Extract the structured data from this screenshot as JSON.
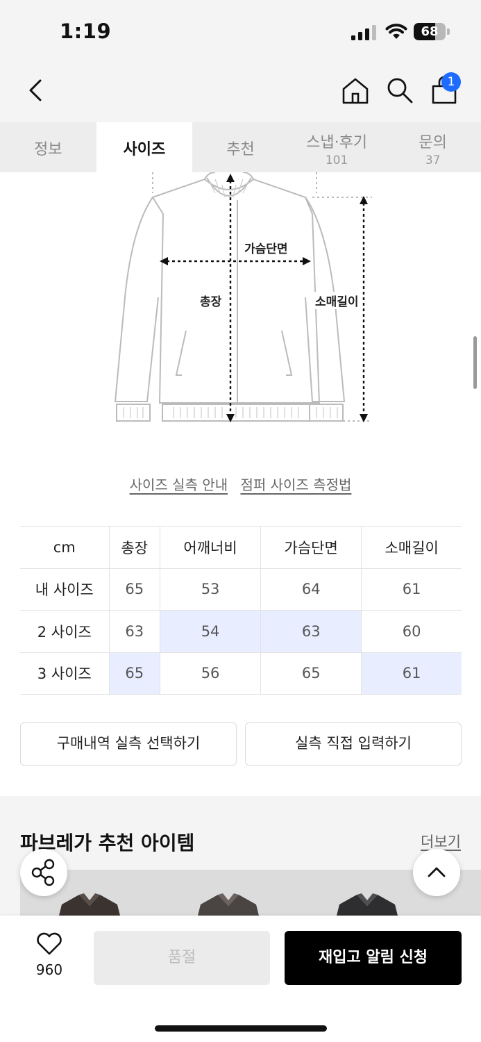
{
  "status": {
    "time": "1:19",
    "battery": "68",
    "battery_level": 0.68
  },
  "header": {
    "cart_badge": "1"
  },
  "tabs": [
    {
      "label": "정보",
      "count": ""
    },
    {
      "label": "사이즈",
      "count": ""
    },
    {
      "label": "추천",
      "count": ""
    },
    {
      "label": "스냅·후기",
      "count": "101"
    },
    {
      "label": "문의",
      "count": "37"
    }
  ],
  "diagram": {
    "chest": "가슴단면",
    "length": "총장",
    "sleeve": "소매길이"
  },
  "links": {
    "guide": "사이즈 실측 안내",
    "measure": "점퍼 사이즈 측정법"
  },
  "size_table": {
    "headers": [
      "cm",
      "총장",
      "어깨너비",
      "가슴단면",
      "소매길이"
    ],
    "rows": [
      {
        "name": "내 사이즈",
        "values": [
          "65",
          "53",
          "64",
          "61"
        ]
      },
      {
        "name": "2 사이즈",
        "values": [
          "63",
          "54",
          "63",
          "60"
        ]
      },
      {
        "name": "3 사이즈",
        "values": [
          "65",
          "56",
          "65",
          "61"
        ]
      }
    ]
  },
  "buttons": {
    "purchase_history": "구매내역 실측 선택하기",
    "direct_input": "실측 직접 입력하기"
  },
  "recommend": {
    "title": "파브레가 추천 아이템",
    "more": "더보기"
  },
  "bottom": {
    "like_count": "960",
    "soldout": "품절",
    "restock": "재입고 알림 신청"
  },
  "colors": {
    "accent": "#1e6bff",
    "highlight": "#e8eeff",
    "primary_button": "#000000"
  }
}
